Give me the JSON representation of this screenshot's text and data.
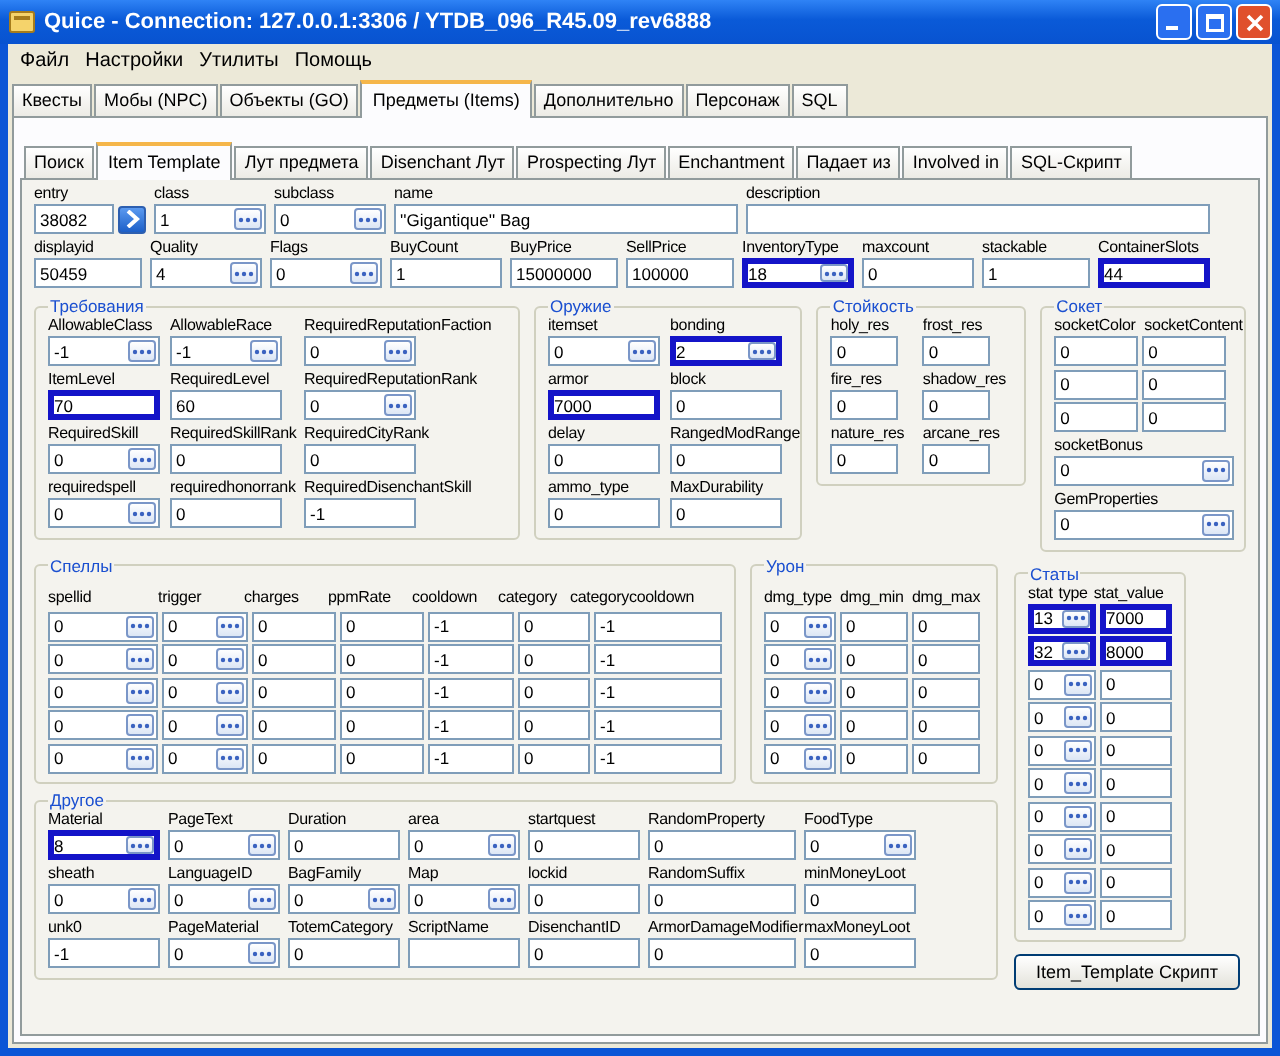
{
  "window": {
    "title": "Quice - Connection: 127.0.0.1:3306 / YTDB_096_R45.09_rev6888"
  },
  "menu": [
    "Файл",
    "Настройки",
    "Утилиты",
    "Помощь"
  ],
  "tabs": [
    {
      "label": "Квесты",
      "selected": false
    },
    {
      "label": "Мобы (NPC)",
      "selected": false
    },
    {
      "label": "Объекты (GO)",
      "selected": false
    },
    {
      "label": "Предметы (Items)",
      "selected": true
    },
    {
      "label": "Дополнительно",
      "selected": false
    },
    {
      "label": "Персонаж",
      "selected": false
    },
    {
      "label": "SQL",
      "selected": false
    }
  ],
  "subtabs": [
    {
      "label": "Поиск",
      "selected": false
    },
    {
      "label": "Item Template",
      "selected": true
    },
    {
      "label": "Лут предмета",
      "selected": false
    },
    {
      "label": "Disenchant Лут",
      "selected": false
    },
    {
      "label": "Prospecting Лут",
      "selected": false
    },
    {
      "label": "Enchantment",
      "selected": false
    },
    {
      "label": "Падает из",
      "selected": false
    },
    {
      "label": "Involved in",
      "selected": false
    },
    {
      "label": "SQL-Скрипт",
      "selected": false
    }
  ],
  "main_rows": [
    [
      {
        "label": "entry",
        "value": "38082",
        "kind": "go",
        "highlighted": false
      },
      {
        "label": "class",
        "value": "1",
        "kind": "lookup",
        "highlighted": false
      },
      {
        "label": "subclass",
        "value": "0",
        "kind": "lookup",
        "highlighted": false
      },
      {
        "label": "name",
        "value": "''Gigantique'' Bag",
        "kind": "text",
        "highlighted": false
      },
      {
        "label": "description",
        "kind": "text",
        "highlighted": false
      }
    ],
    [
      {
        "label": "displayid",
        "value": "50459",
        "kind": "text",
        "highlighted": false
      },
      {
        "label": "Quality",
        "value": "4",
        "kind": "lookup",
        "highlighted": false
      },
      {
        "label": "Flags",
        "value": "0",
        "kind": "lookup",
        "highlighted": false
      },
      {
        "label": "BuyCount",
        "value": "1",
        "kind": "text",
        "highlighted": false
      },
      {
        "label": "BuyPrice",
        "value": "15000000",
        "kind": "text",
        "highlighted": false
      },
      {
        "label": "SellPrice",
        "value": "100000",
        "kind": "text",
        "highlighted": false
      },
      {
        "label": "InventoryType",
        "value": "18",
        "kind": "lookup",
        "highlighted": true
      },
      {
        "label": "maxcount",
        "value": "0",
        "kind": "text",
        "highlighted": false
      },
      {
        "label": "stackable",
        "value": "1",
        "kind": "text",
        "highlighted": false
      },
      {
        "label": "ContainerSlots",
        "value": "44",
        "kind": "text",
        "highlighted": true
      }
    ]
  ],
  "requirements": {
    "title": "Требования",
    "fields": [
      {
        "label": "AllowableClass",
        "value": "-1",
        "kind": "lookup",
        "highlighted": false
      },
      {
        "label": "AllowableRace",
        "value": "-1",
        "kind": "lookup",
        "highlighted": false
      },
      {
        "label": "RequiredReputationFaction",
        "value": "0",
        "kind": "lookup",
        "highlighted": false
      },
      {
        "label": "ItemLevel",
        "value": "70",
        "kind": "text",
        "highlighted": true
      },
      {
        "label": "RequiredLevel",
        "value": "60",
        "kind": "text",
        "highlighted": false
      },
      {
        "label": "RequiredReputationRank",
        "value": "0",
        "kind": "lookup",
        "highlighted": false
      },
      {
        "label": "RequiredSkill",
        "value": "0",
        "kind": "lookup",
        "highlighted": false
      },
      {
        "label": "RequiredSkillRank",
        "value": "0",
        "kind": "text",
        "highlighted": false
      },
      {
        "label": "RequiredCityRank",
        "value": "0",
        "kind": "text",
        "highlighted": false
      },
      {
        "label": "requiredspell",
        "value": "0",
        "kind": "lookup",
        "highlighted": false
      },
      {
        "label": "requiredhonorrank",
        "value": "0",
        "kind": "text",
        "highlighted": false
      },
      {
        "label": "RequiredDisenchantSkill",
        "value": "-1",
        "kind": "text",
        "highlighted": false
      }
    ]
  },
  "weapon": {
    "title": "Оружие",
    "fields": [
      {
        "label": "itemset",
        "value": "0",
        "kind": "lookup",
        "highlighted": false
      },
      {
        "label": "bonding",
        "value": "2",
        "kind": "lookup",
        "highlighted": true
      },
      {
        "label": "armor",
        "value": "7000",
        "kind": "text",
        "highlighted": true
      },
      {
        "label": "block",
        "value": "0",
        "kind": "text",
        "highlighted": false
      },
      {
        "label": "delay",
        "value": "0",
        "kind": "text",
        "highlighted": false
      },
      {
        "label": "RangedModRange",
        "value": "0",
        "kind": "text",
        "highlighted": false
      },
      {
        "label": "ammo_type",
        "value": "0",
        "kind": "text",
        "highlighted": false
      },
      {
        "label": "MaxDurability",
        "value": "0",
        "kind": "text",
        "highlighted": false
      }
    ]
  },
  "resistance": {
    "title": "Стойкость",
    "fields": [
      {
        "label": "holy_res",
        "value": "0",
        "kind": "text",
        "highlighted": false
      },
      {
        "label": "frost_res",
        "value": "0",
        "kind": "text",
        "highlighted": false
      },
      {
        "label": "fire_res",
        "value": "0",
        "kind": "text",
        "highlighted": false
      },
      {
        "label": "shadow_res",
        "value": "0",
        "kind": "text",
        "highlighted": false
      },
      {
        "label": "nature_res",
        "value": "0",
        "kind": "text",
        "highlighted": false
      },
      {
        "label": "arcane_res",
        "value": "0",
        "kind": "text",
        "highlighted": false
      }
    ]
  },
  "socket": {
    "title": "Сокет",
    "columns": [
      "socketColor",
      "socketContent"
    ],
    "rows": [
      [
        "0",
        "0"
      ],
      [
        "0",
        "0"
      ],
      [
        "0",
        "0"
      ]
    ],
    "fields": [
      {
        "label": "socketBonus",
        "value": "0",
        "kind": "lookup",
        "highlighted": false
      },
      {
        "label": "GemProperties",
        "value": "0",
        "kind": "lookup",
        "highlighted": false
      }
    ]
  },
  "spells": {
    "title": "Спеллы",
    "columns": [
      {
        "label": "spellid",
        "kind": "lookup"
      },
      {
        "label": "trigger",
        "kind": "lookup"
      },
      {
        "label": "charges",
        "kind": "text"
      },
      {
        "label": "ppmRate",
        "kind": "text"
      },
      {
        "label": "cooldown",
        "kind": "text"
      },
      {
        "label": "category",
        "kind": "text"
      },
      {
        "label": "categorycooldown",
        "kind": "text"
      }
    ],
    "rows": [
      [
        "0",
        "0",
        "0",
        "0",
        "-1",
        "0",
        "-1"
      ],
      [
        "0",
        "0",
        "0",
        "0",
        "-1",
        "0",
        "-1"
      ],
      [
        "0",
        "0",
        "0",
        "0",
        "-1",
        "0",
        "-1"
      ],
      [
        "0",
        "0",
        "0",
        "0",
        "-1",
        "0",
        "-1"
      ],
      [
        "0",
        "0",
        "0",
        "0",
        "-1",
        "0",
        "-1"
      ]
    ]
  },
  "damage": {
    "title": "Урон",
    "columns": [
      {
        "label": "dmg_type",
        "kind": "lookup"
      },
      {
        "label": "dmg_min",
        "kind": "text"
      },
      {
        "label": "dmg_max",
        "kind": "text"
      }
    ],
    "rows": [
      [
        "0",
        "0",
        "0"
      ],
      [
        "0",
        "0",
        "0"
      ],
      [
        "0",
        "0",
        "0"
      ],
      [
        "0",
        "0",
        "0"
      ],
      [
        "0",
        "0",
        "0"
      ]
    ]
  },
  "stats": {
    "title": "Статы",
    "columns": [
      "stat",
      "type",
      "stat_value"
    ],
    "rows": [
      {
        "stat": "13",
        "stat_value": "7000",
        "highlighted": true
      },
      {
        "stat": "32",
        "stat_value": "8000",
        "highlighted": true
      },
      {
        "stat": "0",
        "stat_value": "0",
        "highlighted": false
      },
      {
        "stat": "0",
        "stat_value": "0",
        "highlighted": false
      },
      {
        "stat": "0",
        "stat_value": "0",
        "highlighted": false
      },
      {
        "stat": "0",
        "stat_value": "0",
        "highlighted": false
      },
      {
        "stat": "0",
        "stat_value": "0",
        "highlighted": false
      },
      {
        "stat": "0",
        "stat_value": "0",
        "highlighted": false
      },
      {
        "stat": "0",
        "stat_value": "0",
        "highlighted": false
      },
      {
        "stat": "0",
        "stat_value": "0",
        "highlighted": false
      }
    ]
  },
  "other": {
    "title": "Другое",
    "fields": [
      {
        "label": "Material",
        "value": "8",
        "kind": "lookup",
        "highlighted": true
      },
      {
        "label": "PageText",
        "value": "0",
        "kind": "lookup",
        "highlighted": false
      },
      {
        "label": "Duration",
        "value": "0",
        "kind": "text",
        "highlighted": false
      },
      {
        "label": "area",
        "value": "0",
        "kind": "lookup",
        "highlighted": false
      },
      {
        "label": "startquest",
        "value": "0",
        "kind": "text",
        "highlighted": false
      },
      {
        "label": "RandomProperty",
        "value": "0",
        "kind": "text",
        "highlighted": false
      },
      {
        "label": "FoodType",
        "value": "0",
        "kind": "lookup",
        "highlighted": false
      },
      {
        "label": "sheath",
        "value": "0",
        "kind": "lookup",
        "highlighted": false
      },
      {
        "label": "LanguageID",
        "value": "0",
        "kind": "lookup",
        "highlighted": false
      },
      {
        "label": "BagFamily",
        "value": "0",
        "kind": "lookup",
        "highlighted": false
      },
      {
        "label": "Map",
        "value": "0",
        "kind": "lookup",
        "highlighted": false
      },
      {
        "label": "lockid",
        "value": "0",
        "kind": "text",
        "highlighted": false
      },
      {
        "label": "RandomSuffix",
        "value": "0",
        "kind": "text",
        "highlighted": false
      },
      {
        "label": "minMoneyLoot",
        "value": "0",
        "kind": "text",
        "highlighted": false
      },
      {
        "label": "unk0",
        "value": "-1",
        "kind": "text",
        "highlighted": false
      },
      {
        "label": "PageMaterial",
        "value": "0",
        "kind": "lookup",
        "highlighted": false
      },
      {
        "label": "TotemCategory",
        "value": "0",
        "kind": "text",
        "highlighted": false
      },
      {
        "label": "ScriptName",
        "kind": "text",
        "highlighted": false
      },
      {
        "label": "DisenchantID",
        "value": "0",
        "kind": "text",
        "highlighted": false
      },
      {
        "label": "ArmorDamageModifier",
        "value": "0",
        "kind": "text",
        "highlighted": false
      },
      {
        "label": "maxMoneyLoot",
        "value": "0",
        "kind": "text",
        "highlighted": false
      }
    ]
  },
  "script_button": "Item_Template Скрипт"
}
